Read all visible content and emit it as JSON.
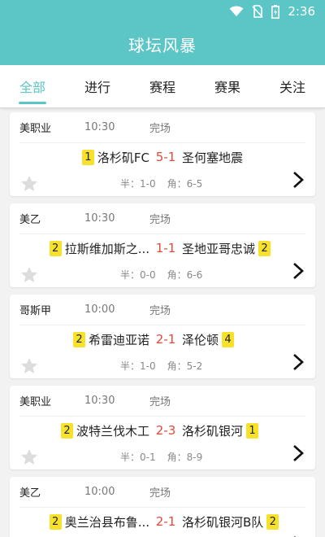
{
  "status_bar": {
    "time": "2:36"
  },
  "app": {
    "title": "球坛风暴"
  },
  "tabs": [
    {
      "label": "全部",
      "active": true
    },
    {
      "label": "进行",
      "active": false
    },
    {
      "label": "赛程",
      "active": false
    },
    {
      "label": "赛果",
      "active": false
    },
    {
      "label": "关注",
      "active": false
    }
  ],
  "matches": [
    {
      "league": "美职业",
      "time": "10:30",
      "status": "完场",
      "home_rank": "1",
      "home": "洛杉矶FC",
      "score": "5-1",
      "away": "圣何塞地震",
      "away_rank": "",
      "half": "半：1-0",
      "corner": "角：6-5"
    },
    {
      "league": "美乙",
      "time": "10:30",
      "status": "完场",
      "home_rank": "2",
      "home": "拉斯维加斯之...",
      "score": "1-1",
      "away": "圣地亚哥忠诚",
      "away_rank": "2",
      "half": "半：0-0",
      "corner": "角：6-6"
    },
    {
      "league": "哥斯甲",
      "time": "10:00",
      "status": "完场",
      "home_rank": "2",
      "home": "希雷迪亚诺",
      "score": "2-1",
      "away": "泽伦顿",
      "away_rank": "4",
      "half": "半：1-0",
      "corner": "角：5-2"
    },
    {
      "league": "美职业",
      "time": "10:30",
      "status": "完场",
      "home_rank": "2",
      "home": "波特兰伐木工",
      "score": "2-3",
      "away": "洛杉矶银河",
      "away_rank": "1",
      "half": "半：0-1",
      "corner": "角：8-9"
    },
    {
      "league": "美乙",
      "time": "10:00",
      "status": "完场",
      "home_rank": "2",
      "home": "奥兰治县布鲁...",
      "score": "2-1",
      "away": "洛杉矶银河B队",
      "away_rank": "2",
      "half": "",
      "corner": ""
    }
  ]
}
